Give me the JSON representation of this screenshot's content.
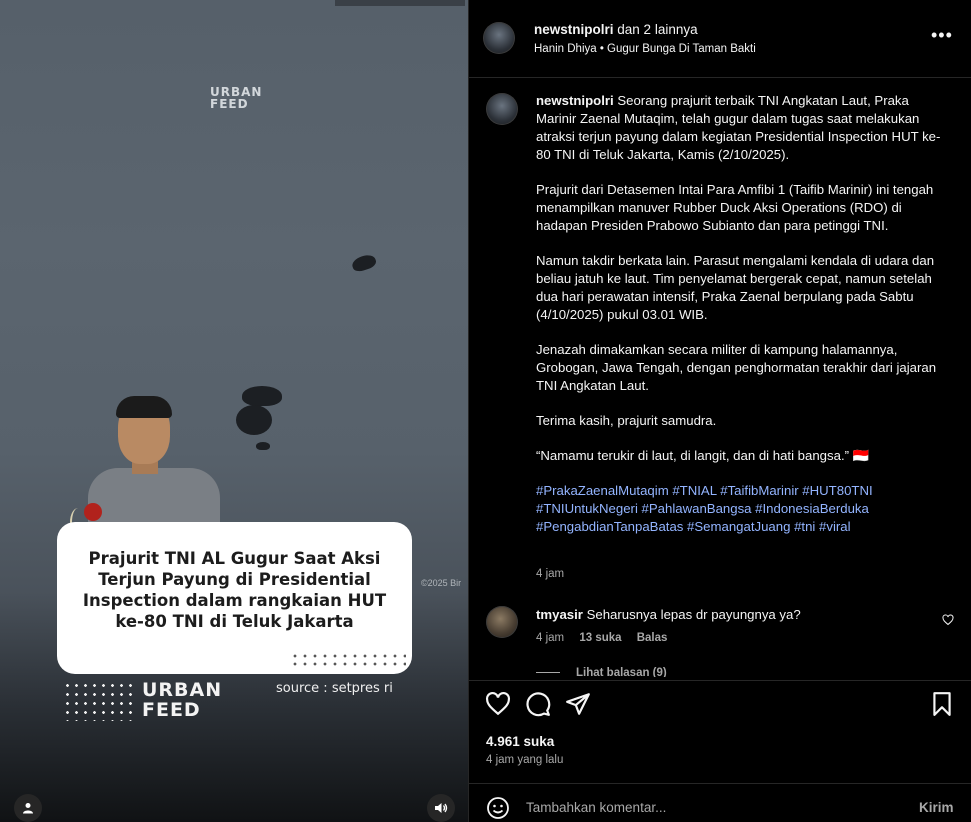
{
  "media": {
    "watermark_top": "URBAN\nFEED",
    "caption": "Prajurit TNI AL Gugur Saat Aksi Terjun Payung di Presidential Inspection dalam rangkaian HUT ke-80 TNI di Teluk Jakarta",
    "copyright": "©2025 Bir",
    "watermark_bottom": "URBAN\nFEED",
    "source": "source : setpres ri"
  },
  "header": {
    "account": "newstnipolri",
    "others": "dan 2 lainnya",
    "subtitle": "Hanin Dhiya • Gugur Bunga Di Taman Bakti"
  },
  "post": {
    "username": "newstnipolri",
    "paragraphs": [
      "Seorang prajurit terbaik TNI Angkatan Laut, Praka Marinir Zaenal Mutaqim, telah gugur dalam tugas saat melakukan atraksi terjun payung dalam kegiatan Presidential Inspection HUT ke-80 TNI di Teluk Jakarta, Kamis (2/10/2025).",
      "Prajurit dari Detasemen Intai Para Amfibi 1 (Taifib Marinir) ini tengah menampilkan manuver Rubber Duck Aksi Operations (RDO) di hadapan Presiden Prabowo Subianto dan para petinggi TNI.",
      "Namun takdir berkata lain. Parasut mengalami kendala di udara dan beliau jatuh ke laut. Tim penyelamat bergerak cepat, namun setelah dua hari perawatan intensif, Praka Zaenal berpulang pada Sabtu (4/10/2025) pukul 03.01 WIB.",
      "Jenazah dimakamkan secara militer di kampung halamannya, Grobogan, Jawa Tengah, dengan penghormatan terakhir dari jajaran TNI Angkatan Laut.",
      "Terima kasih, prajurit samudra.",
      "“Namamu terukir di laut, di langit, dan di hati bangsa.” 🇮🇩"
    ],
    "hashtags": "#PrakaZaenalMutaqim #TNIAL #TaifibMarinir #HUT80TNI #TNIUntukNegeri #PahlawanBangsa #IndonesiaBerduka #PengabdianTanpaBatas #SemangatJuang #tni #viral",
    "time": "4 jam"
  },
  "comment": {
    "username": "tmyasir",
    "text": "Seharusnya lepas dr payungnya ya?",
    "time": "4 jam",
    "likes": "13 suka",
    "reply": "Balas",
    "view_replies": "Lihat balasan (9)"
  },
  "actions": {
    "likes": "4.961 suka",
    "ago": "4 jam yang lalu"
  },
  "composer": {
    "placeholder": "Tambahkan komentar...",
    "send": "Kirim"
  }
}
